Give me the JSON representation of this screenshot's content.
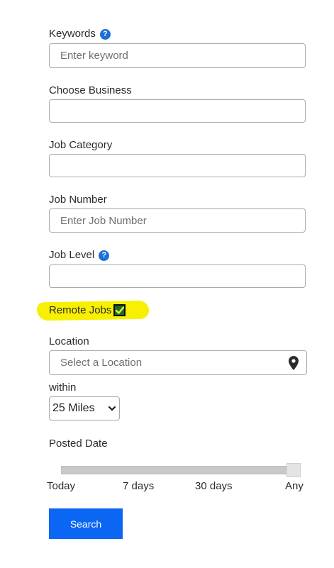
{
  "keywords": {
    "label": "Keywords",
    "placeholder": "Enter keyword",
    "help_icon": "question-circle-icon"
  },
  "business": {
    "label": "Choose Business",
    "value": ""
  },
  "category": {
    "label": "Job Category",
    "value": ""
  },
  "job_number": {
    "label": "Job Number",
    "placeholder": "Enter Job Number"
  },
  "job_level": {
    "label": "Job Level",
    "value": "",
    "help_icon": "question-circle-icon"
  },
  "remote": {
    "label": "Remote Jobs",
    "checked": true,
    "highlight_color": "#f7f000"
  },
  "location": {
    "label": "Location",
    "placeholder": "Select a Location",
    "icon": "map-pin-icon"
  },
  "within": {
    "label": "within",
    "selected": "25 Miles"
  },
  "posted_date": {
    "label": "Posted Date",
    "ticks": [
      "Today",
      "7 days",
      "30 days",
      "Any"
    ],
    "selected": "Any"
  },
  "search_button": {
    "label": "Search",
    "color": "#0a66f3"
  },
  "colors": {
    "accent": "#1a6fd8",
    "check_bg": "#1b6b2c"
  }
}
